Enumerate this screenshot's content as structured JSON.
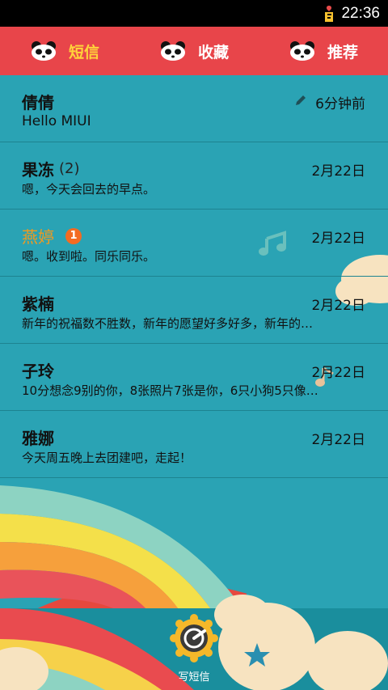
{
  "status_bar": {
    "time": "22:36"
  },
  "tabs": [
    {
      "label": "短信",
      "active": true
    },
    {
      "label": "收藏",
      "active": false
    },
    {
      "label": "推荐",
      "active": false
    }
  ],
  "threads": [
    {
      "name": "倩倩",
      "count": "",
      "date": "6分钟前",
      "snippet": "Hello MIUI",
      "draft": true,
      "unread": ""
    },
    {
      "name": "果冻",
      "count": "(2)",
      "date": "2月22日",
      "snippet": "嗯，今天会回去的早点。",
      "draft": false,
      "unread": ""
    },
    {
      "name": "燕婷",
      "count": "",
      "date": "2月22日",
      "snippet": "嗯。收到啦。同乐同乐。",
      "draft": false,
      "unread": "1"
    },
    {
      "name": "紫楠",
      "count": "",
      "date": "2月22日",
      "snippet": "新年的祝福数不胜数，新年的愿望好多好多，新年的…",
      "draft": false,
      "unread": ""
    },
    {
      "name": "子玲",
      "count": "",
      "date": "2月22日",
      "snippet": "10分想念9别的你，8张照片7张是你，6只小狗5只像…",
      "draft": false,
      "unread": ""
    },
    {
      "name": "雅娜",
      "count": "",
      "date": "2月22日",
      "snippet": "今天周五晚上去团建吧，走起！",
      "draft": false,
      "unread": ""
    }
  ],
  "compose": {
    "label": "写短信"
  },
  "colors": {
    "tab_bar": "#e8454a",
    "active_tab": "#ffd33a",
    "background": "#2aa3b4",
    "unread_name": "#f39a1d",
    "badge": "#f36b22"
  }
}
